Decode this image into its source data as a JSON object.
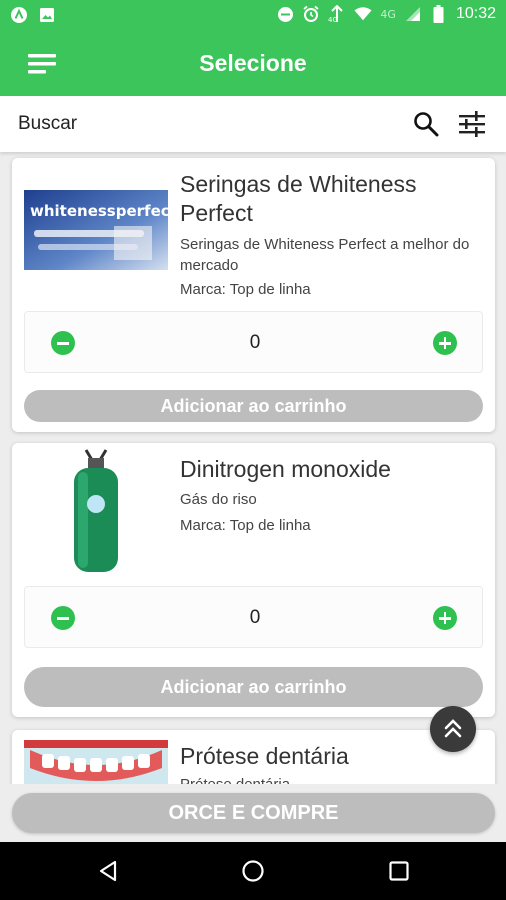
{
  "status_bar": {
    "time": "10:32",
    "network": "4G",
    "left_icons": [
      "app-notification-icon",
      "image-icon"
    ],
    "right_icons": [
      "do-not-disturb-icon",
      "alarm-icon",
      "lte-icon",
      "wifi-icon",
      "signal-icon",
      "battery-icon"
    ]
  },
  "app_bar": {
    "title": "Selecione",
    "menu_icon": "menu-icon",
    "color": "#3cc55b"
  },
  "search": {
    "placeholder": "Buscar",
    "search_icon": "search-icon",
    "filter_icon": "filter-sliders-icon"
  },
  "products": [
    {
      "title": "Seringas de Whiteness Perfect",
      "description": "Seringas de Whiteness Perfect a melhor do mercado",
      "brand": "Marca: Top de linha",
      "quantity": "0",
      "add_label": "Adicionar ao carrinho",
      "image_text": "whitenessperfect"
    },
    {
      "title": "Dinitrogen monoxide",
      "description": "Gás do riso",
      "brand": "Marca: Top de linha",
      "quantity": "0",
      "add_label": "Adicionar ao carrinho"
    },
    {
      "title": "Prótese dentária",
      "description": "Prótese dentária"
    }
  ],
  "cta": {
    "label": "ORCE E COMPRE"
  },
  "colors": {
    "accent": "#3cc55b",
    "quantity_button": "#2ec14f",
    "disabled_button": "#bdbdbd",
    "fab": "#3a3a3a"
  }
}
